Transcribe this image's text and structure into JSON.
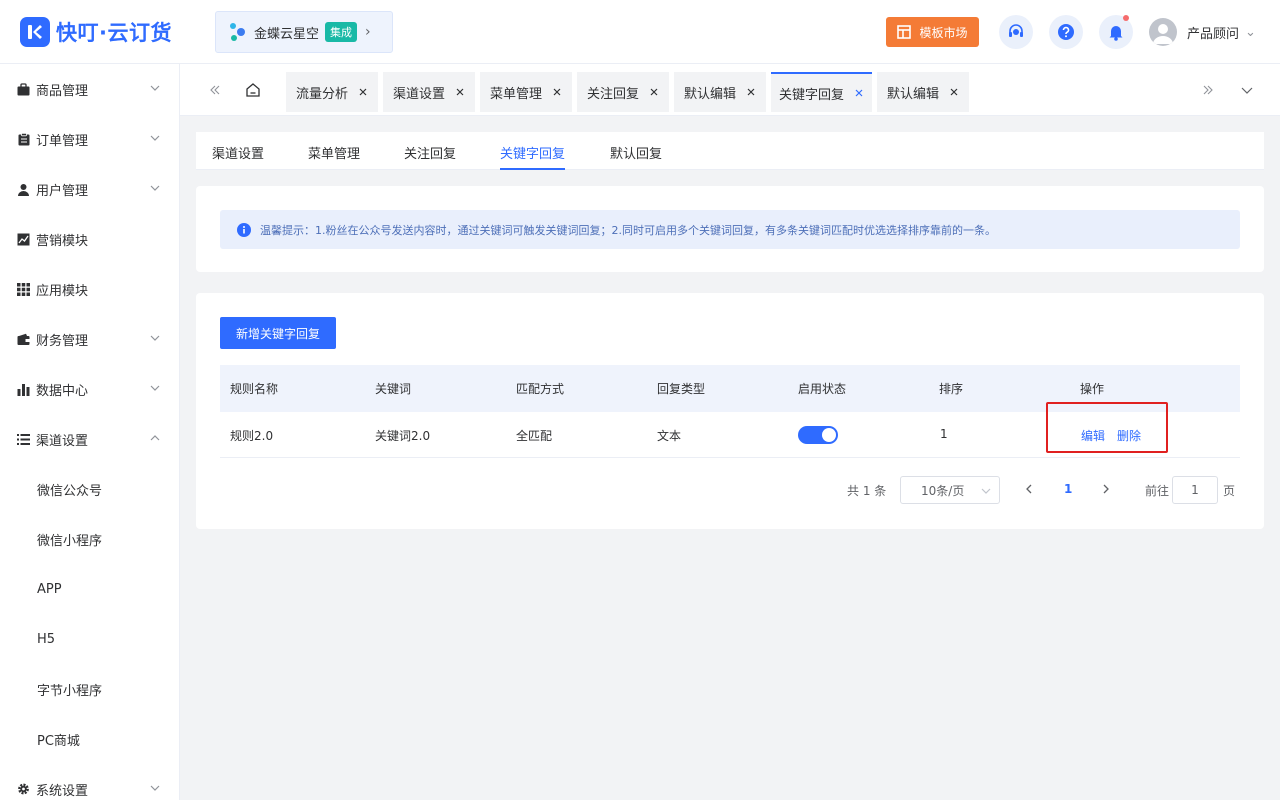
{
  "header": {
    "logo_text": "快叮·云订货",
    "partner": {
      "name": "金蝶云星空",
      "badge": "集成"
    },
    "market_label": "模板市场",
    "user_name": "产品顾问"
  },
  "sidebar": {
    "menu": [
      {
        "label": "商品管理",
        "icon": "bag-icon",
        "arrow": "down"
      },
      {
        "label": "订单管理",
        "icon": "clipboard-icon",
        "arrow": "down"
      },
      {
        "label": "用户管理",
        "icon": "user-icon",
        "arrow": "down"
      },
      {
        "label": "营销模块",
        "icon": "chart-line-icon",
        "arrow": ""
      },
      {
        "label": "应用模块",
        "icon": "grid-icon",
        "arrow": ""
      },
      {
        "label": "财务管理",
        "icon": "wallet-icon",
        "arrow": "down"
      },
      {
        "label": "数据中心",
        "icon": "bar-chart-icon",
        "arrow": "down"
      },
      {
        "label": "渠道设置",
        "icon": "list-icon",
        "arrow": "up"
      }
    ],
    "submenu": [
      "微信公众号",
      "微信小程序",
      "APP",
      "H5",
      "字节小程序",
      "PC商城"
    ],
    "bottom": {
      "label": "系统设置",
      "icon": "gear-icon"
    }
  },
  "tabs": [
    "流量分析",
    "渠道设置",
    "菜单管理",
    "关注回复",
    "默认编辑",
    "关键字回复",
    "默认编辑"
  ],
  "active_tab": 5,
  "subtabs": [
    "渠道设置",
    "菜单管理",
    "关注回复",
    "关键字回复",
    "默认回复"
  ],
  "active_subtab": 3,
  "tip": "温馨提示：1.粉丝在公众号发送内容时，通过关键词可触发关键词回复；2.同时可启用多个关键词回复，有多条关键词匹配时优选选择排序靠前的一条。",
  "table": {
    "add_button": "新增关键字回复",
    "columns": [
      "规则名称",
      "关键词",
      "匹配方式",
      "回复类型",
      "启用状态",
      "排序",
      "操作"
    ],
    "rows": [
      {
        "name": "规则2.0",
        "keyword": "关键词2.0",
        "match": "全匹配",
        "reply_type": "文本",
        "enabled": true,
        "sort": "1",
        "actions": [
          "编辑",
          "删除"
        ]
      }
    ]
  },
  "pagination": {
    "total": "共 1 条",
    "page_size": "10条/页",
    "current_page": "1",
    "goto_label": "前往",
    "goto_value": "1",
    "page_unit": "页"
  },
  "colors": {
    "primary": "#2f6bff",
    "market": "#f47b36",
    "badge": "#19b9a6",
    "highlight": "#e02020"
  }
}
